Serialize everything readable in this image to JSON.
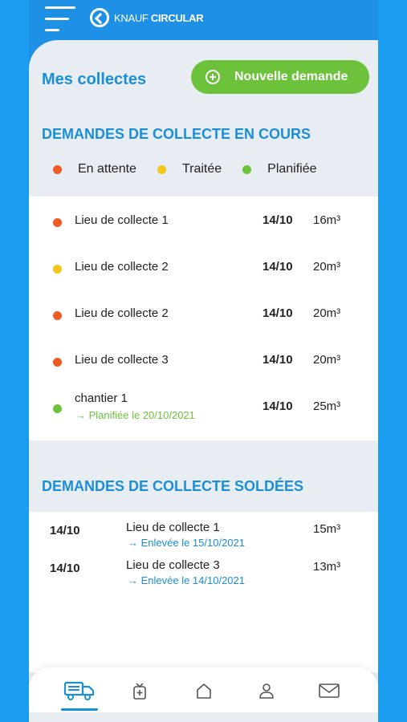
{
  "header": {
    "brand": "KNAUF",
    "brand_sub": "CIRCULAR"
  },
  "page": {
    "title": "Mes collectes",
    "new_request_label": "Nouvelle demande"
  },
  "current": {
    "title": "DEMANDES DE COLLECTE EN COURS",
    "legend": [
      {
        "label": "En attente",
        "color": "#ee5b24"
      },
      {
        "label": "Traitée",
        "color": "#f5c518"
      },
      {
        "label": "Planifiée",
        "color": "#6cc33b"
      }
    ],
    "rows": [
      {
        "name": "Lieu de collecte 1",
        "date": "14/10",
        "volume": "16m³",
        "status_color": "#ee5b24"
      },
      {
        "name": "Lieu de collecte 2",
        "date": "14/10",
        "volume": "20m³",
        "status_color": "#f5c518"
      },
      {
        "name": "Lieu de collecte 2",
        "date": "14/10",
        "volume": "20m³",
        "status_color": "#ee5b24"
      },
      {
        "name": "Lieu de collecte 3",
        "date": "14/10",
        "volume": "20m³",
        "status_color": "#ee5b24"
      },
      {
        "name": "chantier 1",
        "date": "14/10",
        "volume": "25m³",
        "status_color": "#6cc33b",
        "sub": "→ Planifiée le 20/10/2021"
      }
    ]
  },
  "done": {
    "title": "DEMANDES DE COLLECTE SOLDÉES",
    "rows": [
      {
        "date": "14/10",
        "name": "Lieu de collecte 1",
        "sub": "→ Enlevée le 15/10/2021",
        "volume": "15m³"
      },
      {
        "date": "14/10",
        "name": "Lieu de collecte 3",
        "sub": "→ Enlevée le 14/10/2021",
        "volume": "13m³"
      }
    ]
  },
  "nav": {
    "items": [
      {
        "icon": "truck-icon",
        "active": true
      },
      {
        "icon": "bag-plus-icon",
        "active": false
      },
      {
        "icon": "home-icon",
        "active": false
      },
      {
        "icon": "user-icon",
        "active": false
      },
      {
        "icon": "mail-icon",
        "active": false
      }
    ]
  },
  "colors": {
    "accent": "#1a8fd8",
    "green": "#6cc33b",
    "header": "#1e90e6"
  }
}
